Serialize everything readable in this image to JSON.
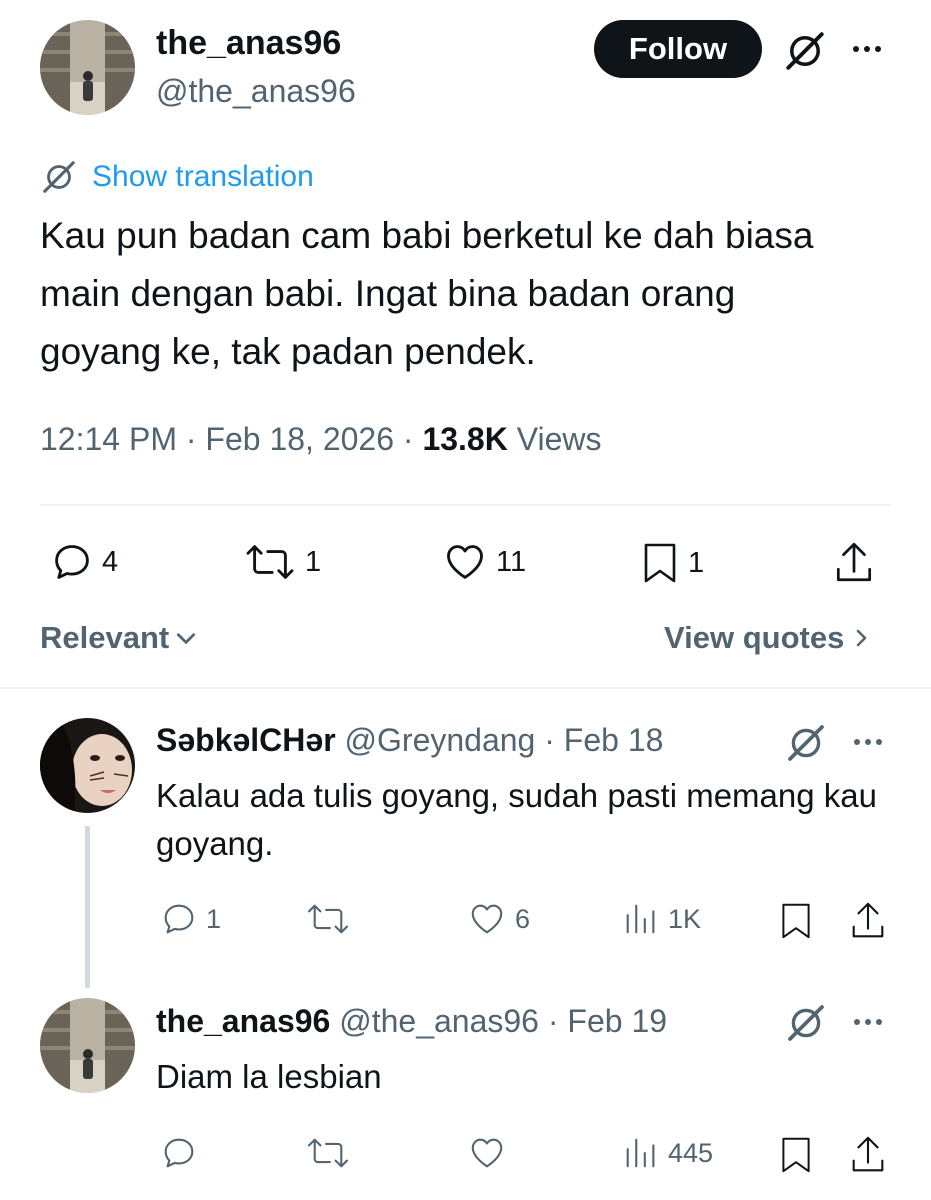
{
  "main_tweet": {
    "display_name": "the_anas96",
    "handle": "@the_anas96",
    "follow_label": "Follow",
    "show_translation_label": "Show translation",
    "text": "Kau pun badan cam babi berketul ke dah biasa main dengan babi. Ingat bina badan orang goyang ke, tak padan pendek.",
    "time": "12:14 PM",
    "date": "Feb 18, 2026",
    "views_count": "13.8K",
    "views_label": "Views",
    "replies": "4",
    "reposts": "1",
    "likes": "11",
    "bookmarks": "1"
  },
  "sort": {
    "relevant_label": "Relevant",
    "view_quotes_label": "View quotes"
  },
  "replies": [
    {
      "display_name": "SəbkəlCHər",
      "handle": "@Greyndang",
      "date": "Feb 18",
      "text": "Kalau ada tulis goyang, sudah pasti memang kau goyang.",
      "replies": "1",
      "reposts": "",
      "likes": "6",
      "views": "1K"
    },
    {
      "display_name": "the_anas96",
      "handle": "@the_anas96",
      "date": "Feb 19",
      "text": "Diam la lesbian",
      "replies": "",
      "reposts": "",
      "likes": "",
      "views": "445"
    }
  ],
  "icons": {
    "grok": "grok-icon",
    "more": "more-icon",
    "reply": "reply-icon",
    "repost": "repost-icon",
    "like": "like-icon",
    "bookmark": "bookmark-icon",
    "share": "share-icon",
    "views": "views-icon",
    "translate": "translate-icon"
  },
  "colors": {
    "follow_bg": "#0f1419",
    "link": "#1d9bf0",
    "muted": "#536471",
    "divider": "#eff3f4",
    "thread_line": "#cfd9de"
  }
}
